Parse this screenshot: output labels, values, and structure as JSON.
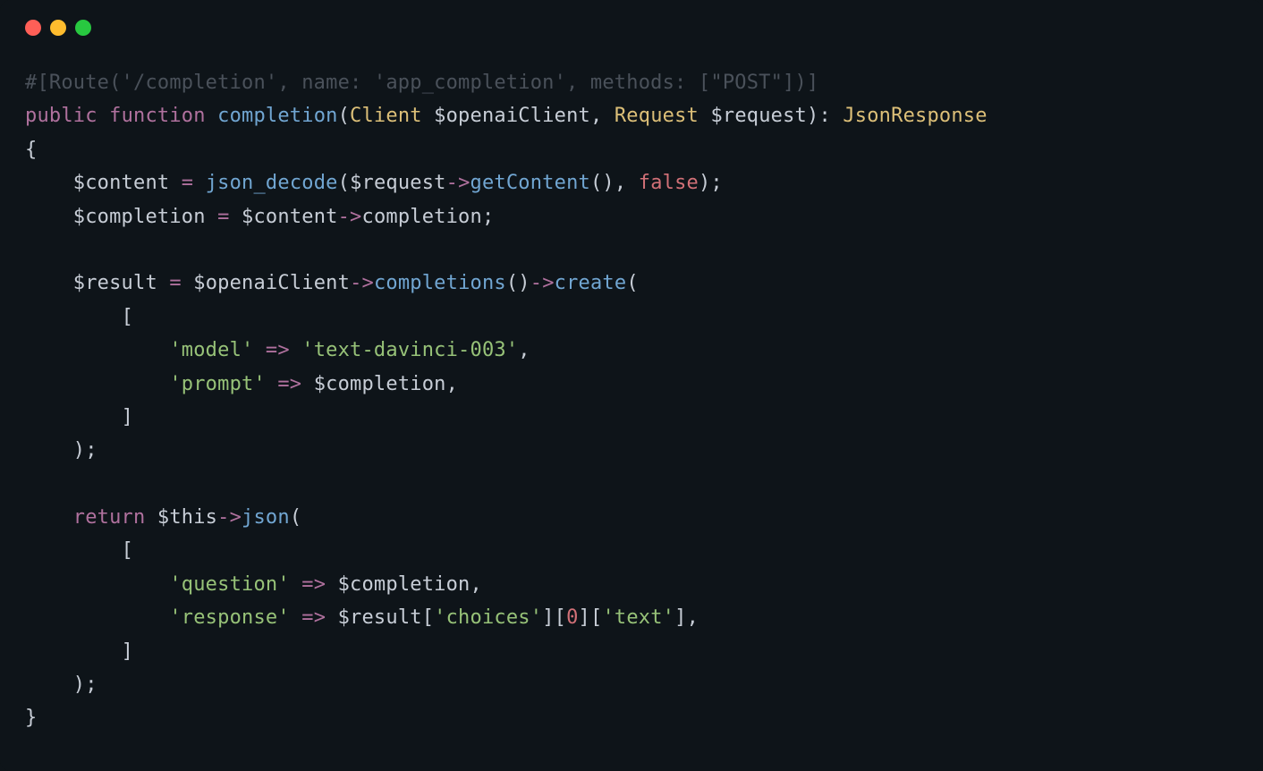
{
  "code": {
    "line1": {
      "full": "#[Route('/completion', name: 'app_completion', methods: [\"POST\"])]"
    },
    "line2": {
      "kw_public": "public",
      "kw_function": "function",
      "fn_name": "completion",
      "type_client": "Client",
      "var_openai": "$openaiClient",
      "type_request": "Request",
      "var_request": "$request",
      "type_response": "JsonResponse"
    },
    "line3": {
      "brace": "{"
    },
    "line4": {
      "var_content": "$content",
      "eq": "=",
      "fn_json_decode": "json_decode",
      "var_request": "$request",
      "arrow": "->",
      "fn_getcontent": "getContent",
      "paren": "()",
      "comma": ", ",
      "false_kw": "false",
      "close": ");"
    },
    "line5": {
      "var_completion": "$completion",
      "eq": "=",
      "var_content": "$content",
      "arrow": "->",
      "prop": "completion",
      "semi": ";"
    },
    "line7": {
      "var_result": "$result",
      "eq": "=",
      "var_openai": "$openaiClient",
      "arrow1": "->",
      "fn_completions": "completions",
      "paren": "()",
      "arrow2": "->",
      "fn_create": "create",
      "open": "("
    },
    "line8": {
      "bracket": "["
    },
    "line9": {
      "key_model": "'model'",
      "fat_arrow": "=>",
      "val_model": "'text-davinci-003'",
      "comma": ","
    },
    "line10": {
      "key_prompt": "'prompt'",
      "fat_arrow": "=>",
      "var_completion": "$completion",
      "comma": ","
    },
    "line11": {
      "bracket": "]"
    },
    "line12": {
      "close": ");"
    },
    "line14": {
      "kw_return": "return",
      "var_this": "$this",
      "arrow": "->",
      "fn_json": "json",
      "open": "("
    },
    "line15": {
      "bracket": "["
    },
    "line16": {
      "key_question": "'question'",
      "fat_arrow": "=>",
      "var_completion": "$completion",
      "comma": ","
    },
    "line17": {
      "key_response": "'response'",
      "fat_arrow": "=>",
      "var_result": "$result",
      "idx_choices_open": "[",
      "idx_choices": "'choices'",
      "idx_choices_close": "]",
      "idx0_open": "[",
      "idx0": "0",
      "idx0_close": "]",
      "idx_text_open": "[",
      "idx_text": "'text'",
      "idx_text_close": "]",
      "comma": ","
    },
    "line18": {
      "bracket": "]"
    },
    "line19": {
      "close": ");"
    },
    "line20": {
      "brace": "}"
    }
  }
}
